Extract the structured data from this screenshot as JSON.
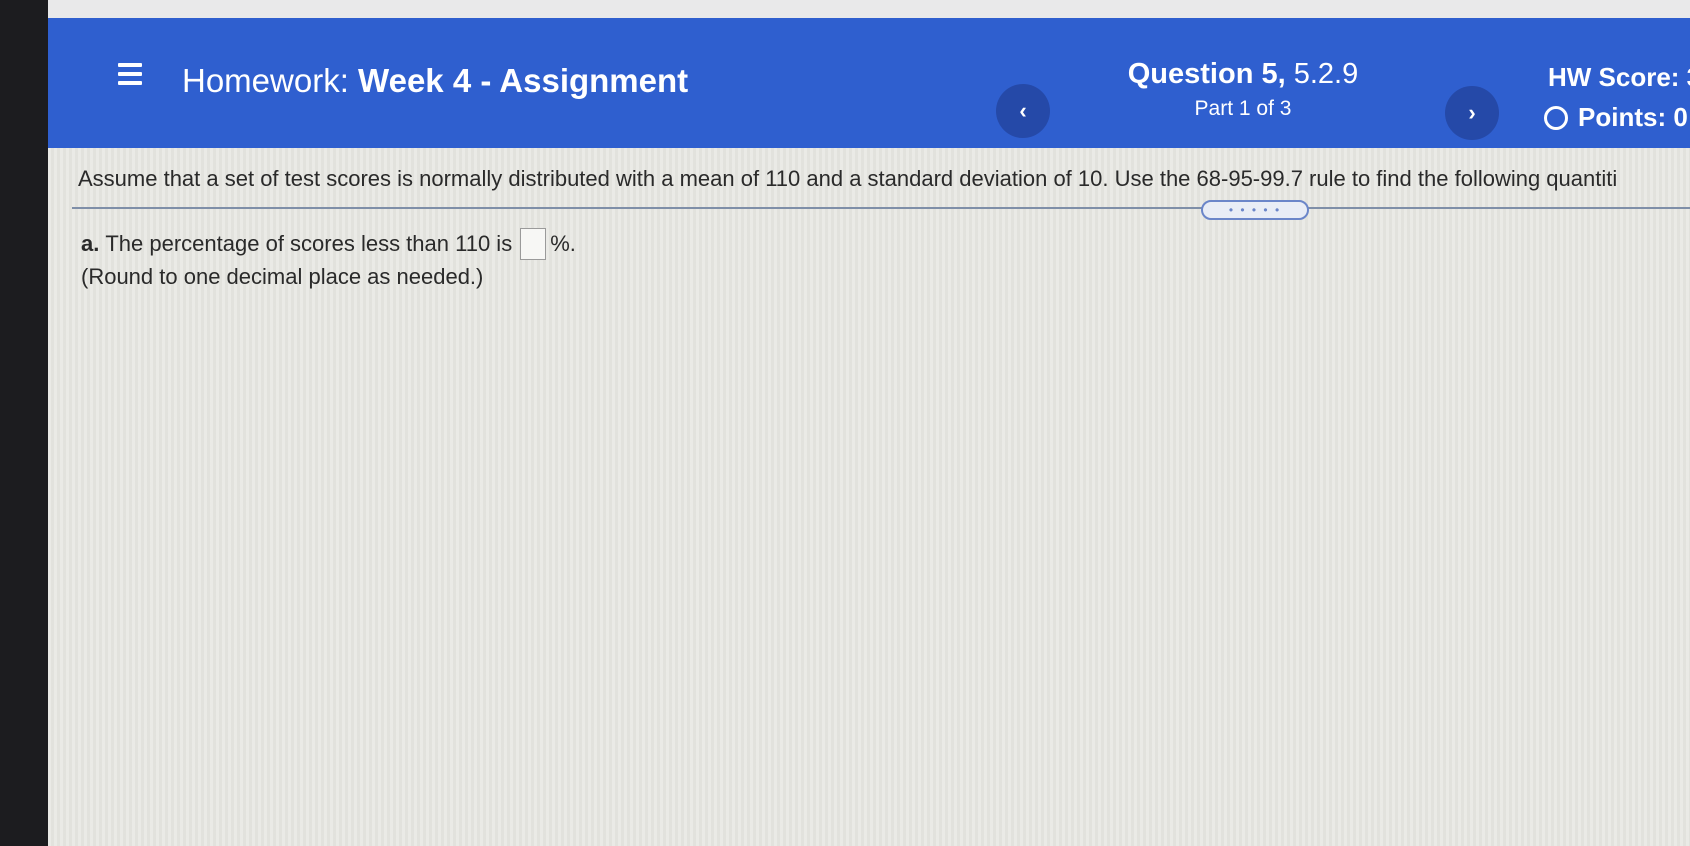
{
  "header": {
    "menu_icon": "hamburger-menu-icon",
    "title_label": "Homework:",
    "assignment_name": "Week 4 - Assignment",
    "prev_label": "‹",
    "next_label": "›",
    "question_label": "Question 5,",
    "question_number": "5.2.9",
    "part_text": "Part 1 of 3",
    "hw_score_label": "HW Score: 3",
    "points_label": "Points: 0",
    "accent_color": "#2f5fcf"
  },
  "content": {
    "problem_text": "Assume that a set of test scores is normally distributed with a mean of 110 and a standard deviation of 10. Use the 68-95-99.7 rule to find the following quantiti",
    "expand_handle_label": "• • • • •",
    "part_a": {
      "letter": "a.",
      "text_before": "The percentage of scores less than 110 is",
      "answer_value": "",
      "text_after": "%.",
      "note": "(Round to one decimal place as needed.)"
    }
  }
}
